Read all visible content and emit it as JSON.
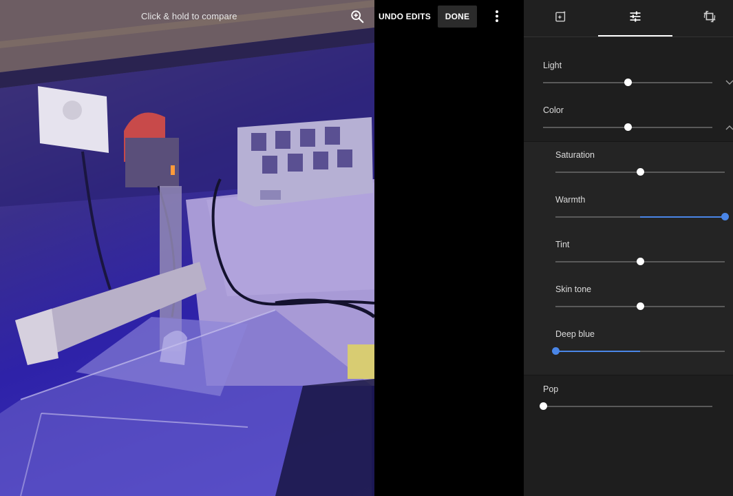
{
  "photo": {
    "compare_hint": "Click & hold to compare",
    "zoom_icon": "zoom-in-icon"
  },
  "toolbar": {
    "undo_label": "UNDO EDITS",
    "done_label": "DONE",
    "more_icon": "more-vert-icon"
  },
  "tabs": [
    {
      "name": "auto-enhance",
      "icon": "auto-enhance-icon",
      "active": false
    },
    {
      "name": "adjust",
      "icon": "tune-sliders-icon",
      "active": true
    },
    {
      "name": "crop-rotate",
      "icon": "crop-rotate-icon",
      "active": false
    }
  ],
  "adjust": {
    "light": {
      "label": "Light",
      "value": 0.5,
      "expanded": false
    },
    "color": {
      "label": "Color",
      "value": 0.5,
      "expanded": true
    },
    "color_sub": [
      {
        "label": "Saturation",
        "value": 0.5
      },
      {
        "label": "Warmth",
        "value": 1.0
      },
      {
        "label": "Tint",
        "value": 0.5
      },
      {
        "label": "Skin tone",
        "value": 0.5
      },
      {
        "label": "Deep blue",
        "value": 0.0
      }
    ],
    "pop": {
      "label": "Pop",
      "value": 0.0
    }
  },
  "colors": {
    "accent": "#4a86e8",
    "panel_bg": "#1e1e1e",
    "sub_panel_bg": "#242424"
  }
}
